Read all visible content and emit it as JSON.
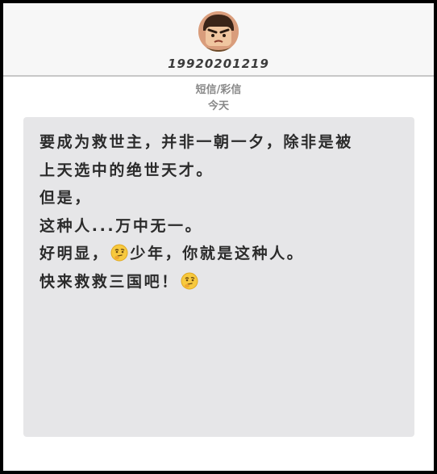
{
  "header": {
    "sender": "19920201219",
    "avatar_icon": "cartoon-warrior-avatar"
  },
  "meta": {
    "message_type": "短信/彩信",
    "date": "今天"
  },
  "message": {
    "line1": "要成为救世主，并非一朝一夕，除非是被",
    "line2": "上天选中的绝世天才。",
    "line3": "但是，",
    "line4": "这种人...万中无一。",
    "line5_before": "好明显，",
    "line5_emoji": "thinking-face-icon",
    "line5_after": "少年，你就是这种人。",
    "line6_text": "快来救救三国吧！",
    "line6_emoji": "thinking-face-icon"
  },
  "colors": {
    "bubble": "#e6e6e8",
    "text": "#2b2b2b",
    "meta_text": "#888888"
  }
}
